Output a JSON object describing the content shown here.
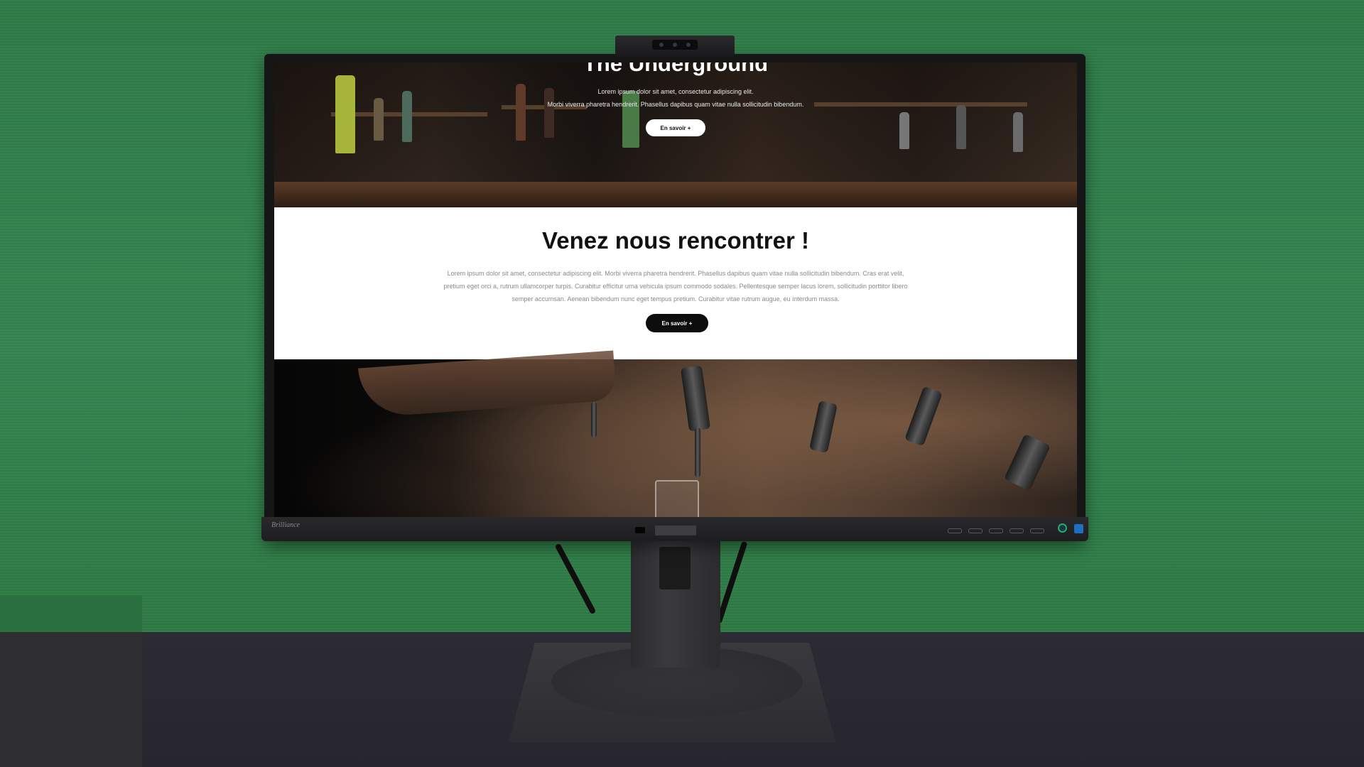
{
  "monitor": {
    "brand": "Brilliance",
    "osd_labels": [
      "",
      "",
      "",
      "",
      ""
    ]
  },
  "website": {
    "hero": {
      "title": "The Underground",
      "line1": "Lorem ipsum dolor sit amet, consectetur adipiscing elit.",
      "line2": "Morbi viverra pharetra hendrerit. Phasellus dapibus quam vitae nulla sollicitudin bibendum.",
      "cta_label": "En savoir +"
    },
    "meet": {
      "title": "Venez nous rencontrer !",
      "body": "Lorem ipsum dolor sit amet, consectetur adipiscing elit. Morbi viverra pharetra hendrerit. Phasellus dapibus quam vitae nulla sollicitudin bibendum. Cras erat velit, pretium eget orci a, rutrum ullamcorper turpis. Curabitur efficitur urna vehicula ipsum commodo sodales. Pellentesque semper lacus lorem, sollicitudin porttitor libero semper accumsan. Aenean bibendum nunc eget tempus pretium. Curabitur vitae rutrum augue, eu interdum massa.",
      "cta_label": "En savoir +"
    },
    "taps_image": "beer-taps-photo"
  },
  "colors": {
    "backdrop": "#2f7b48",
    "button_white": "#ffffff",
    "button_black": "#0d0d0d"
  }
}
